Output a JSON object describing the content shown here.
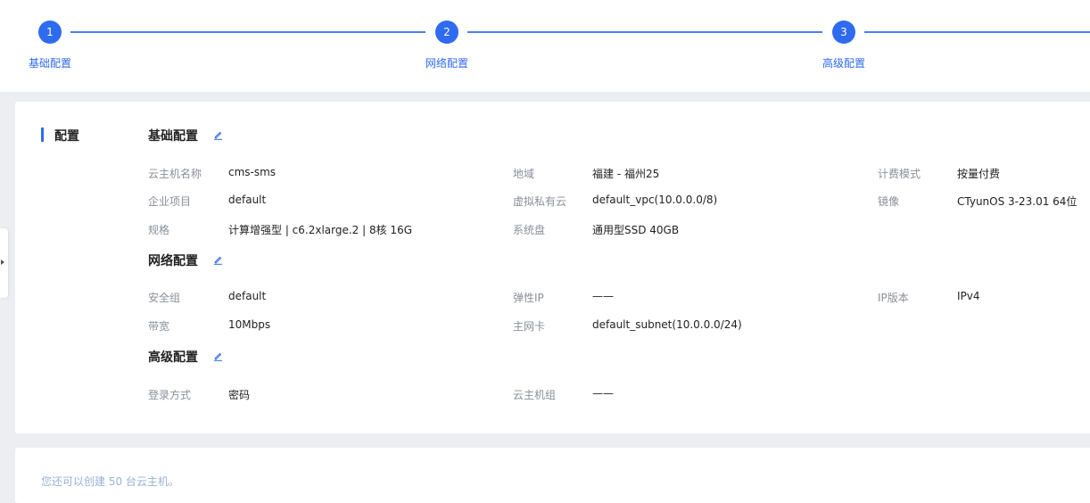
{
  "steps": [
    {
      "number": "1",
      "label": "基础配置"
    },
    {
      "number": "2",
      "label": "网络配置"
    },
    {
      "number": "3",
      "label": "高级配置"
    }
  ],
  "config": {
    "title": "配置",
    "sections": {
      "basic": {
        "title": "基础配置",
        "fields": {
          "name_label": "云主机名称",
          "name_value": "cms-sms",
          "region_label": "地域",
          "region_value": "福建 - 福州25",
          "billing_label": "计费模式",
          "billing_value": "按量付费",
          "project_label": "企业项目",
          "project_value": "default",
          "vpc_label": "虚拟私有云",
          "vpc_value": "default_vpc(10.0.0.0/8)",
          "image_label": "镜像",
          "image_value": "CTyunOS 3-23.01 64位",
          "spec_label": "规格",
          "spec_value": "计算增强型 | c6.2xlarge.2 | 8核 16G",
          "disk_label": "系统盘",
          "disk_value": "通用型SSD 40GB"
        }
      },
      "network": {
        "title": "网络配置",
        "fields": {
          "sg_label": "安全组",
          "sg_value": "default",
          "eip_label": "弹性IP",
          "eip_value": "——",
          "ipver_label": "IP版本",
          "ipver_value": "IPv4",
          "bw_label": "带宽",
          "bw_value": "10Mbps",
          "nic_label": "主网卡",
          "nic_value": "default_subnet(10.0.0.0/24)"
        }
      },
      "advanced": {
        "title": "高级配置",
        "fields": {
          "login_label": "登录方式",
          "login_value": "密码",
          "group_label": "云主机组",
          "group_value": "——"
        }
      }
    }
  },
  "quota_text": "您还可以创建 50 台云主机。",
  "colors": {
    "accent": "#2f6bf0",
    "label": "#8a8f99"
  }
}
